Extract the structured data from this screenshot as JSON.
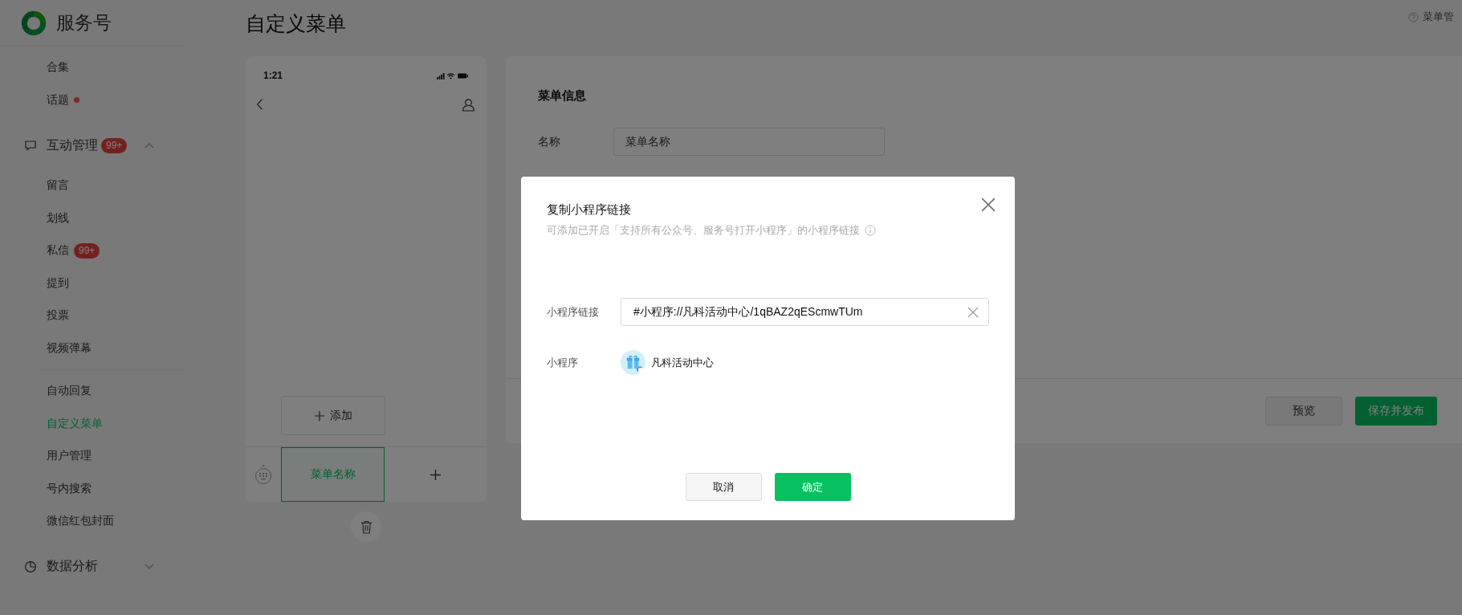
{
  "brand": {
    "name": "服务号"
  },
  "page_title": "自定义菜单",
  "help_link": "菜单管",
  "sidebar": {
    "sections": [
      {
        "items": [
          {
            "label": "合集",
            "selected": false,
            "dot": false
          },
          {
            "label": "话题",
            "selected": false,
            "dot": true
          }
        ]
      },
      {
        "group": {
          "label": "互动管理",
          "badge": "99+",
          "expanded": true
        },
        "items": [
          {
            "label": "留言",
            "selected": false,
            "dot": false
          },
          {
            "label": "划线",
            "selected": false,
            "dot": false
          },
          {
            "label": "私信",
            "selected": false,
            "dot": false,
            "badge": "99+"
          },
          {
            "label": "提到",
            "selected": false,
            "dot": false
          },
          {
            "label": "投票",
            "selected": false,
            "dot": false
          },
          {
            "label": "视频弹幕",
            "selected": false,
            "dot": false
          }
        ]
      },
      {
        "items": [
          {
            "label": "自动回复",
            "selected": false,
            "dot": false
          },
          {
            "label": "自定义菜单",
            "selected": true,
            "dot": false
          },
          {
            "label": "用户管理",
            "selected": false,
            "dot": false
          },
          {
            "label": "号内搜索",
            "selected": false,
            "dot": false
          },
          {
            "label": "微信红包封面",
            "selected": false,
            "dot": false
          }
        ]
      },
      {
        "group": {
          "label": "数据分析",
          "expanded": false
        }
      }
    ]
  },
  "phone": {
    "time": "1:21",
    "add_popup": "添加",
    "menu_buttons": [
      {
        "label": "菜单名称",
        "selected": true
      }
    ]
  },
  "menu_info": {
    "heading": "菜单信息",
    "name_label": "名称",
    "name_value": "菜单名称",
    "buttons": [
      {
        "label": "预览",
        "kind": "secondary"
      },
      {
        "label": "保存并发布",
        "kind": "primary"
      }
    ]
  },
  "dialog": {
    "title": "复制小程序链接",
    "subtitle": "可添加已开启「支持所有公众号、服务号打开小程序」的小程序链接",
    "link_label": "小程序链接",
    "link_value": "#小程序://凡科活动中心/1qBAZ2qEScmwTUm",
    "app_label": "小程序",
    "app_name": "凡科活动中心",
    "buttons": [
      {
        "label": "取消",
        "kind": "secondary"
      },
      {
        "label": "确定",
        "kind": "primary"
      }
    ]
  }
}
